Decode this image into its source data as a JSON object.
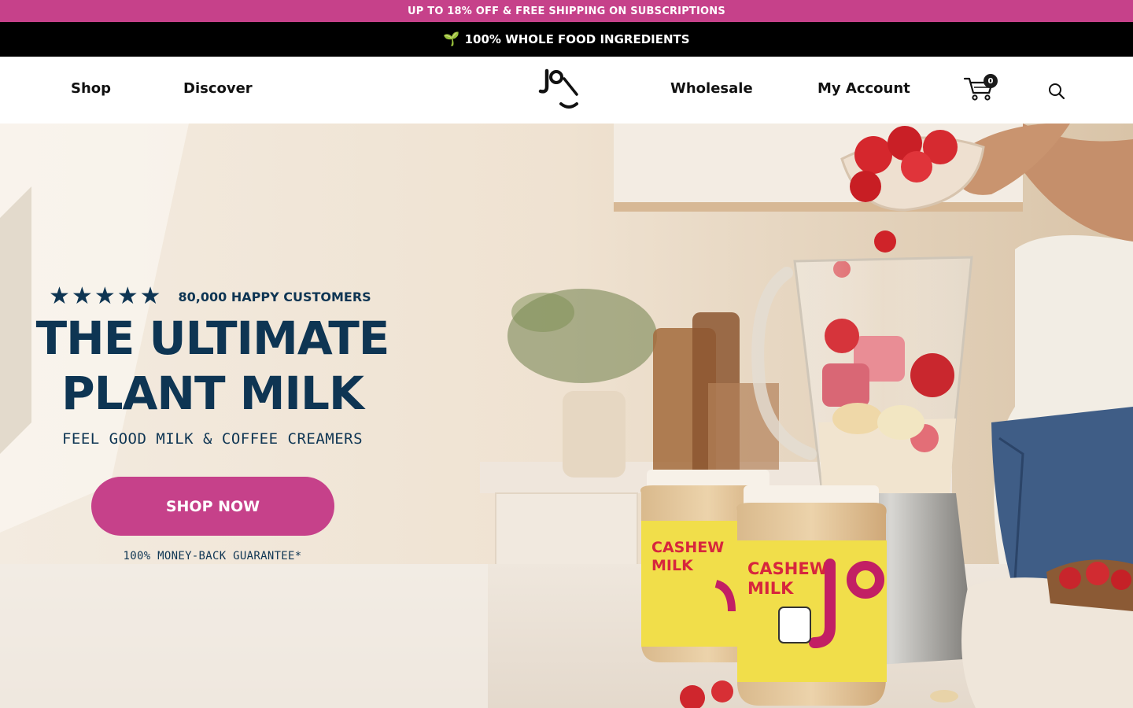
{
  "promo": {
    "text": "UP TO 18% OFF & FREE SHIPPING ON SUBSCRIPTIONS"
  },
  "info_bar": {
    "text": "100% WHOLE FOOD INGREDIENTS",
    "icon": "sprout-icon"
  },
  "nav": {
    "shop": "Shop",
    "discover": "Discover",
    "wholesale": "Wholesale",
    "my_account": "My Account",
    "cart_count": "0"
  },
  "hero": {
    "rating_text": "80,000 HAPPY CUSTOMERS",
    "stars": 5,
    "headline_line1": "THE ULTIMATE",
    "headline_line2": "PLANT MILK",
    "subhead": "FEEL GOOD MILK & COFFEE CREAMERS",
    "cta": "SHOP NOW",
    "guarantee": "100% MONEY-BACK GUARANTEE*",
    "jar_label_line1": "CASHEW",
    "jar_label_line2": "MILK"
  },
  "colors": {
    "accent": "#c6418a",
    "navy": "#0e3553",
    "black": "#000000"
  }
}
